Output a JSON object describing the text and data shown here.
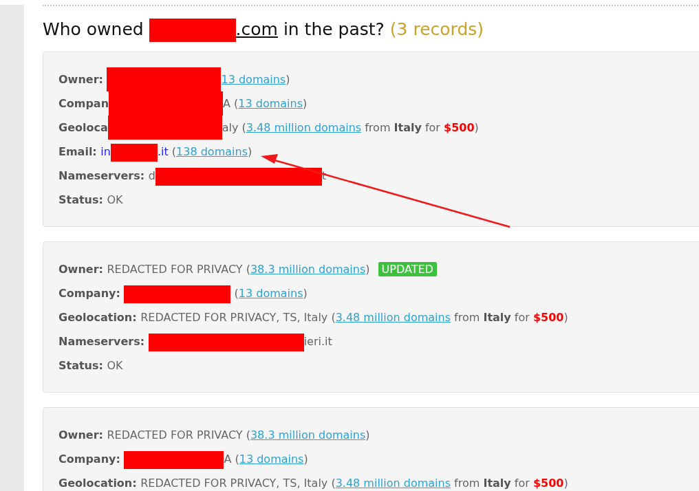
{
  "heading": {
    "parts": [
      {
        "kind": "text",
        "text": "Who owned "
      },
      {
        "kind": "redacted"
      },
      {
        "kind": "link",
        "text": ".com"
      },
      {
        "kind": "text",
        "text": " in the past? "
      },
      {
        "kind": "count",
        "text": "(3 records)"
      }
    ]
  },
  "records": [
    {
      "lines": [
        {
          "segments": [
            {
              "kind": "label",
              "text": "Owner: "
            },
            {
              "kind": "redacted"
            },
            {
              "kind": "link",
              "text": "13 domains"
            },
            {
              "kind": "text",
              "text": ")"
            }
          ]
        },
        {
          "segments": [
            {
              "kind": "label",
              "text": "Compan"
            },
            {
              "kind": "covered"
            },
            {
              "kind": "text",
              "text": "A ("
            },
            {
              "kind": "link",
              "text": "13 domains"
            },
            {
              "kind": "text",
              "text": ")"
            }
          ]
        },
        {
          "segments": [
            {
              "kind": "label",
              "text": "Geoloca"
            },
            {
              "kind": "covered"
            },
            {
              "kind": "text",
              "text": "aly ("
            },
            {
              "kind": "link",
              "text": "3.48 million domains"
            },
            {
              "kind": "text",
              "text": " from "
            },
            {
              "kind": "bold",
              "text": "Italy"
            },
            {
              "kind": "text",
              "text": " for "
            },
            {
              "kind": "price",
              "text": "$500"
            },
            {
              "kind": "text",
              "text": ")"
            }
          ]
        },
        {
          "segments": [
            {
              "kind": "label",
              "text": "Email: "
            },
            {
              "kind": "email",
              "text": "in"
            },
            {
              "kind": "redacted"
            },
            {
              "kind": "email",
              "text": ".it"
            },
            {
              "kind": "text",
              "text": " ("
            },
            {
              "kind": "link",
              "text": "138 domains"
            },
            {
              "kind": "text",
              "text": ")"
            }
          ]
        },
        {
          "segments": [
            {
              "kind": "label",
              "text": "Nameservers: "
            },
            {
              "kind": "text",
              "text": "d"
            },
            {
              "kind": "redacted"
            },
            {
              "kind": "text",
              "text": "t"
            }
          ]
        },
        {
          "segments": [
            {
              "kind": "label",
              "text": "Status: "
            },
            {
              "kind": "text",
              "text": "OK"
            }
          ]
        }
      ]
    },
    {
      "lines": [
        {
          "segments": [
            {
              "kind": "label",
              "text": "Owner: "
            },
            {
              "kind": "text",
              "text": "REDACTED FOR PRIVACY ("
            },
            {
              "kind": "link",
              "text": "38.3 million domains"
            },
            {
              "kind": "text",
              "text": ")"
            },
            {
              "kind": "badge",
              "text": "UPDATED"
            }
          ]
        },
        {
          "segments": [
            {
              "kind": "label",
              "text": "Company: "
            },
            {
              "kind": "redacted"
            },
            {
              "kind": "text",
              "text": " ("
            },
            {
              "kind": "link",
              "text": "13 domains"
            },
            {
              "kind": "text",
              "text": ")"
            }
          ]
        },
        {
          "segments": [
            {
              "kind": "label",
              "text": "Geolocation: "
            },
            {
              "kind": "text",
              "text": "REDACTED FOR PRIVACY, TS, Italy ("
            },
            {
              "kind": "link",
              "text": "3.48 million domains"
            },
            {
              "kind": "text",
              "text": " from "
            },
            {
              "kind": "bold",
              "text": "Italy"
            },
            {
              "kind": "text",
              "text": " for "
            },
            {
              "kind": "price",
              "text": "$500"
            },
            {
              "kind": "text",
              "text": ")"
            }
          ]
        },
        {
          "segments": [
            {
              "kind": "label",
              "text": "Nameservers: "
            },
            {
              "kind": "redacted"
            },
            {
              "kind": "text",
              "text": "ieri.it"
            }
          ]
        },
        {
          "segments": [
            {
              "kind": "label",
              "text": "Status: "
            },
            {
              "kind": "text",
              "text": "OK"
            }
          ]
        }
      ]
    },
    {
      "lines": [
        {
          "segments": [
            {
              "kind": "label",
              "text": "Owner: "
            },
            {
              "kind": "text",
              "text": "REDACTED FOR PRIVACY ("
            },
            {
              "kind": "link",
              "text": "38.3 million domains"
            },
            {
              "kind": "text",
              "text": ")"
            }
          ]
        },
        {
          "segments": [
            {
              "kind": "label",
              "text": "Company: "
            },
            {
              "kind": "redacted"
            },
            {
              "kind": "text",
              "text": "A ("
            },
            {
              "kind": "link",
              "text": "13 domains"
            },
            {
              "kind": "text",
              "text": ")"
            }
          ]
        },
        {
          "segments": [
            {
              "kind": "label",
              "text": "Geolocation: "
            },
            {
              "kind": "text",
              "text": "REDACTED FOR PRIVACY, TS, Italy ("
            },
            {
              "kind": "link",
              "text": "3.48 million domains"
            },
            {
              "kind": "text",
              "text": " from "
            },
            {
              "kind": "bold",
              "text": "Italy"
            },
            {
              "kind": "text",
              "text": " for "
            },
            {
              "kind": "price",
              "text": "$500"
            },
            {
              "kind": "text",
              "text": ")"
            }
          ]
        }
      ]
    }
  ],
  "annotation": {
    "kind": "arrow"
  }
}
